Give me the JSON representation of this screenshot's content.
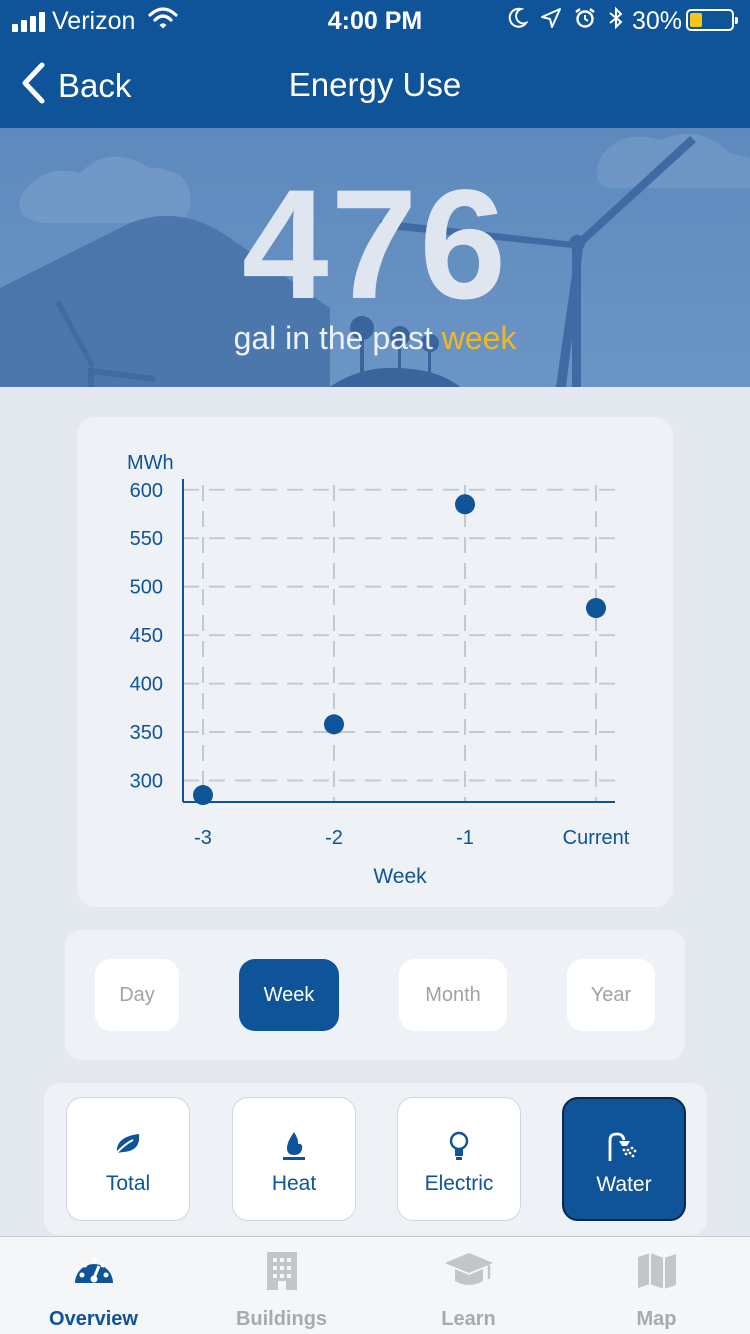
{
  "status_bar": {
    "carrier": "Verizon",
    "time": "4:00 PM",
    "battery_percent": "30%",
    "battery_level": 0.3
  },
  "nav": {
    "back_label": "Back",
    "title": "Energy Use"
  },
  "hero": {
    "value": "476",
    "caption_prefix": "gal in the past",
    "caption_period": "week"
  },
  "chart_data": {
    "type": "scatter",
    "ylabel": "MWh",
    "xlabel": "Week",
    "x_categories": [
      "-3",
      "-2",
      "-1",
      "Current"
    ],
    "y_ticks": [
      "600",
      "550",
      "500",
      "450",
      "400",
      "350",
      "300"
    ],
    "ylim": [
      283,
      608
    ],
    "values": [
      285,
      358,
      585,
      478
    ],
    "grid": true,
    "color": "#0f5399"
  },
  "period_selector": {
    "options": [
      "Day",
      "Week",
      "Month",
      "Year"
    ],
    "selected": "Week"
  },
  "categories": {
    "items": [
      "Total",
      "Heat",
      "Electric",
      "Water"
    ],
    "selected": "Water"
  },
  "tab_bar": {
    "items": [
      "Overview",
      "Buildings",
      "Learn",
      "Map"
    ],
    "selected": "Overview"
  },
  "colors": {
    "primary": "#0f5399",
    "accent": "#f2b824",
    "inactive": "#a8abae"
  }
}
